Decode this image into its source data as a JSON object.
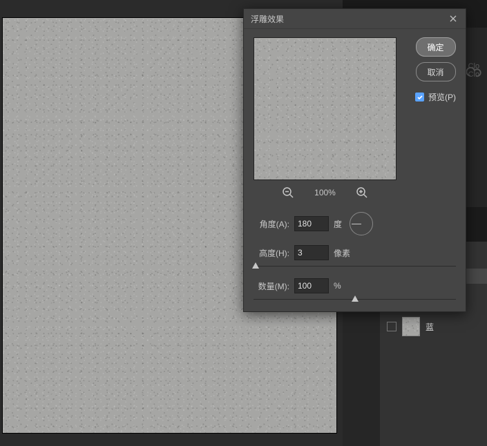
{
  "dialog": {
    "title": "浮雕效果",
    "ok_label": "确定",
    "cancel_label": "取消",
    "preview_label": "预览(P)",
    "preview_checked": true,
    "zoom_level": "100%",
    "controls": {
      "angle": {
        "label": "角度(A):",
        "value": "180",
        "unit": "度"
      },
      "height": {
        "label": "高度(H):",
        "value": "3",
        "unit": "像素",
        "slider_pos_pct": 1
      },
      "amount": {
        "label": "数量(M):",
        "value": "100",
        "unit": "%",
        "slider_pos_pct": 50
      }
    }
  },
  "right_panel": {
    "cc_text_1": "ve Clo",
    "cc_text_2": "ve Clo",
    "layer_name": "蓝"
  }
}
